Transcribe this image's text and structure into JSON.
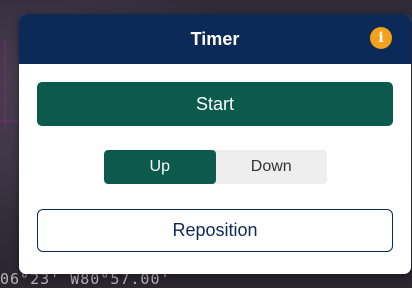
{
  "background": {
    "coordinates_text": "06°23' W80°57.00'"
  },
  "dialog": {
    "title": "Timer",
    "info_icon_glyph": "i",
    "start_label": "Start",
    "direction": {
      "options": [
        "Up",
        "Down"
      ],
      "selected": "Up"
    },
    "reposition_label": "Reposition"
  },
  "colors": {
    "header_bg": "#0c2a57",
    "accent_green": "#0b5a4c",
    "info_orange": "#f2a21b"
  },
  "icons": {
    "info": "info-icon"
  }
}
